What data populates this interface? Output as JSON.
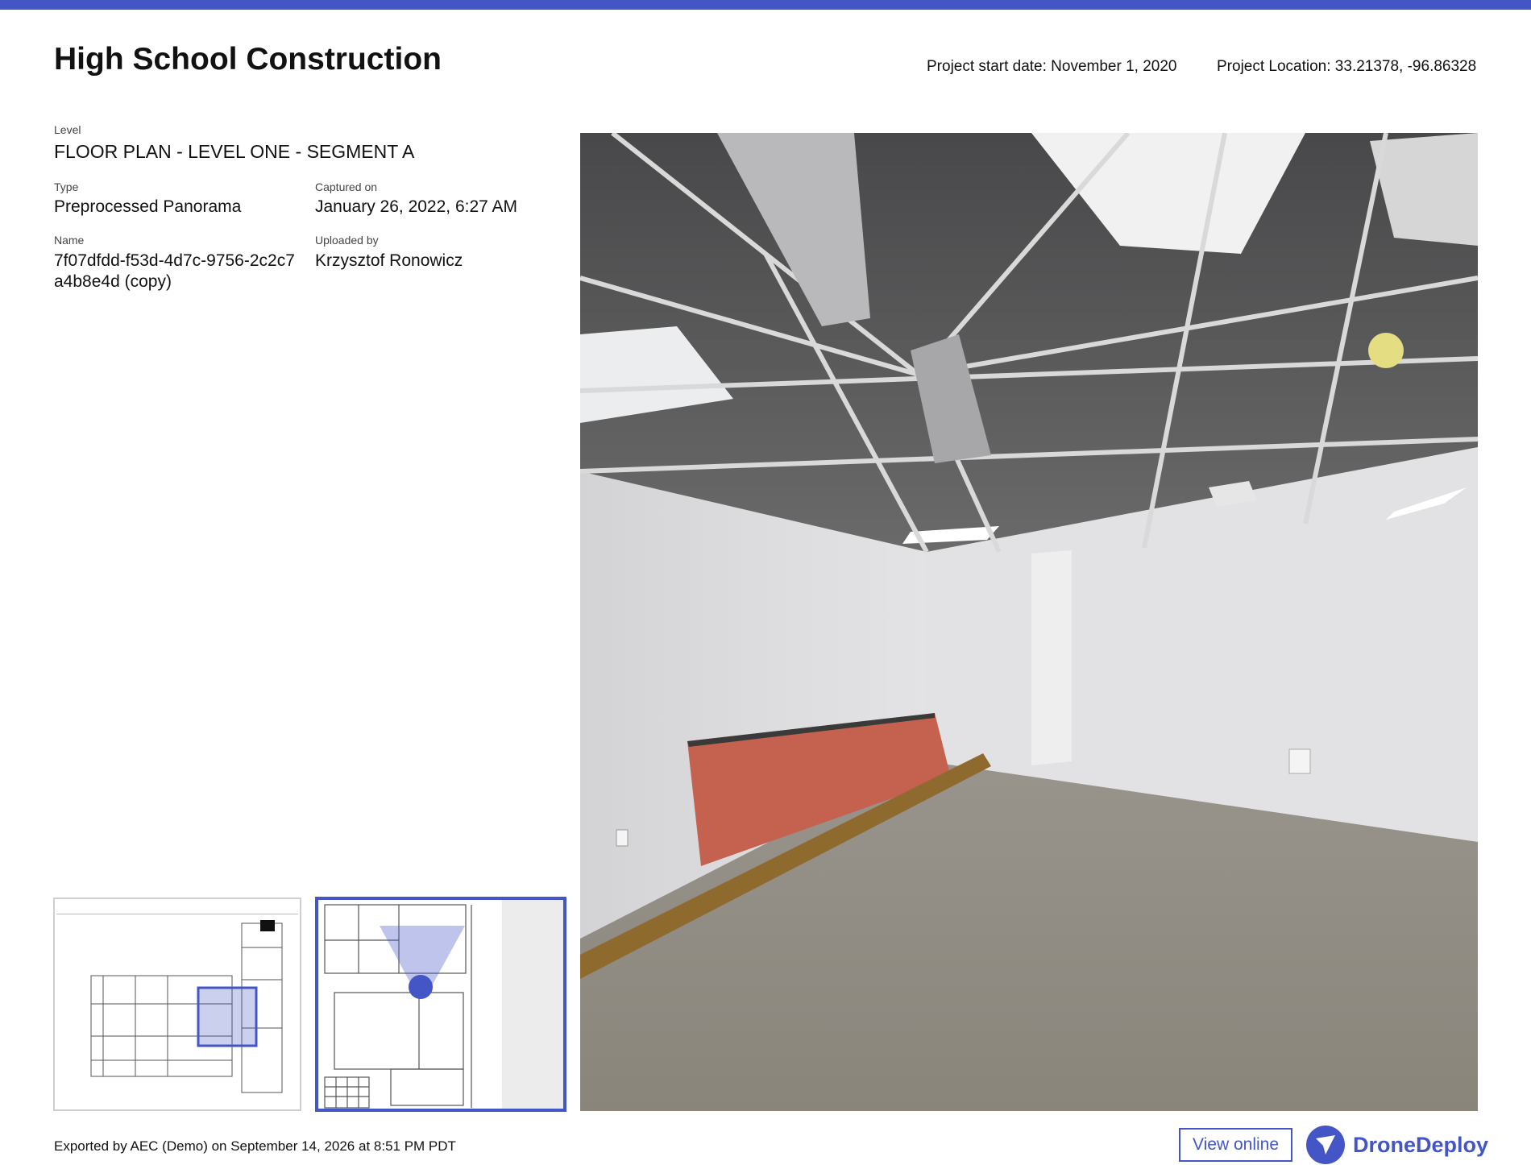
{
  "header": {
    "title": "High School Construction",
    "project_start": "Project start date: November 1, 2020",
    "project_location": "Project Location: 33.21378, -96.86328"
  },
  "details": {
    "level_label": "Level",
    "level_value": "FLOOR PLAN - LEVEL ONE - SEGMENT A",
    "type_label": "Type",
    "type_value": "Preprocessed Panorama",
    "captured_label": "Captured on",
    "captured_value": "January 26, 2022, 6:27 AM",
    "name_label": "Name",
    "name_value": "7f07dfdd-f53d-4d7c-9756-2c2c7a4b8e4d (copy)",
    "uploaded_label": "Uploaded by",
    "uploaded_value": "Krzysztof Ronowicz"
  },
  "footer": {
    "exported": "Exported by AEC (Demo) on September 14, 2026 at 8:51 PM PDT",
    "view_online": "View online",
    "brand": "DroneDeploy"
  },
  "colors": {
    "accent": "#4456c6",
    "plywood": "#c4624f"
  },
  "icons": {
    "brand_logo": "dronedeploy-logo-icon",
    "position_marker": "location-dot-icon"
  }
}
